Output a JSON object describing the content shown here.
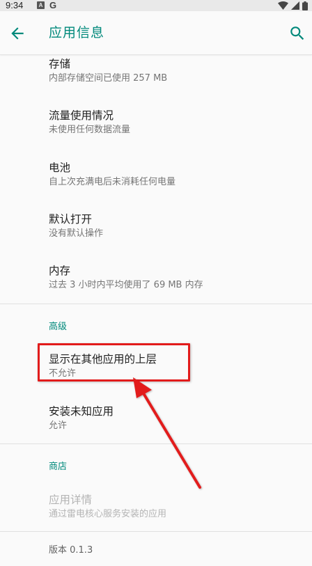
{
  "status_bar": {
    "time": "9:34",
    "notif_a": "A",
    "notif_g": "G",
    "icons": [
      "wifi-icon",
      "signal-icon",
      "battery-icon"
    ]
  },
  "app_bar": {
    "title": "应用信息",
    "back_icon": "arrow-back-icon",
    "search_icon": "search-icon",
    "accent_color": "#00897b"
  },
  "items": {
    "storage": {
      "title": "存储",
      "subtitle": "内部存储空间已使用 257 MB"
    },
    "data_usage": {
      "title": "流量使用情况",
      "subtitle": "未使用任何数据流量"
    },
    "battery": {
      "title": "电池",
      "subtitle": "自上次充满电后未消耗任何电量"
    },
    "open_by_default": {
      "title": "默认打开",
      "subtitle": "没有默认操作"
    },
    "memory": {
      "title": "内存",
      "subtitle": "过去 3 小时内平均使用了 69 MB 内存"
    }
  },
  "advanced": {
    "header": "高级",
    "display_over_apps": {
      "title": "显示在其他应用的上层",
      "subtitle": "不允许"
    },
    "install_unknown_apps": {
      "title": "安装未知应用",
      "subtitle": "允许"
    }
  },
  "store": {
    "header": "商店",
    "app_details": {
      "title": "应用详情",
      "subtitle": "通过雷电核心服务安装的应用"
    }
  },
  "version": "版本 0.1.3",
  "annotation": {
    "highlight_color": "#e21b1b"
  }
}
